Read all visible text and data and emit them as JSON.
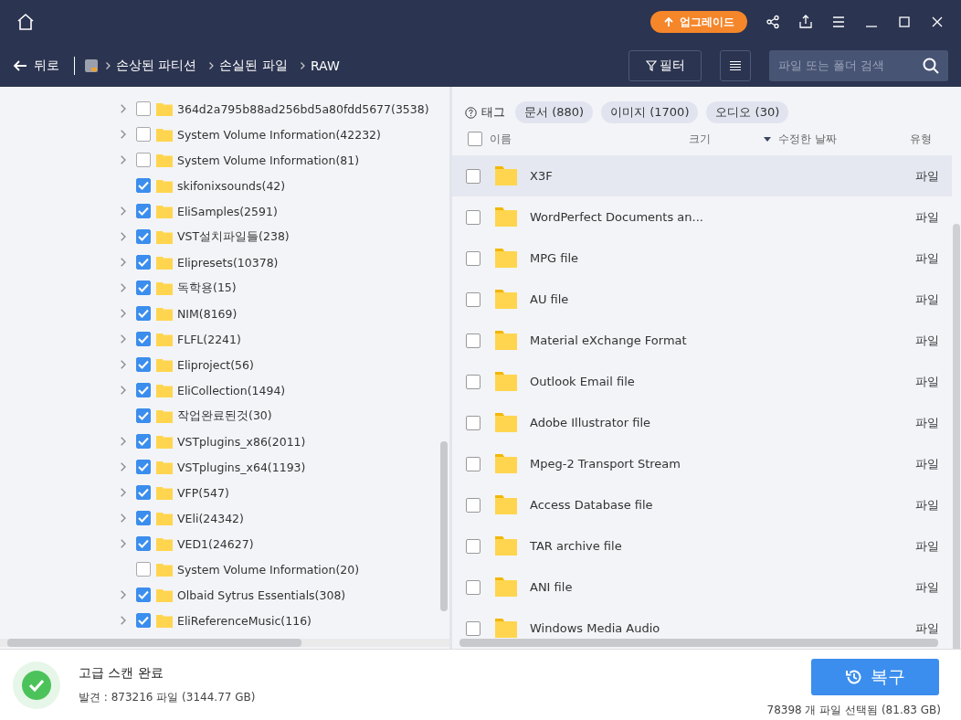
{
  "upgrade_button": "업그레이드",
  "nav": {
    "back": "뒤로",
    "breadcrumbs": [
      "손상된 파티션",
      "손실된 파일",
      "RAW"
    ],
    "filter": "필터",
    "search": {
      "placeholder": "파일 또는 폴더 검색"
    }
  },
  "tree": [
    {
      "label": "364d2a795b88ad256bd5a80fdd5677(3538)",
      "expandable": true,
      "checked": false
    },
    {
      "label": "System Volume Information(42232)",
      "expandable": true,
      "checked": false
    },
    {
      "label": "System Volume Information(81)",
      "expandable": true,
      "checked": false
    },
    {
      "label": "skifonixsounds(42)",
      "expandable": false,
      "checked": true
    },
    {
      "label": "EliSamples(2591)",
      "expandable": true,
      "checked": true
    },
    {
      "label": "VST설치파일들(238)",
      "expandable": true,
      "checked": true
    },
    {
      "label": "Elipresets(10378)",
      "expandable": true,
      "checked": true
    },
    {
      "label": "독학용(15)",
      "expandable": true,
      "checked": true
    },
    {
      "label": "NIM(8169)",
      "expandable": true,
      "checked": true
    },
    {
      "label": "FLFL(2241)",
      "expandable": true,
      "checked": true
    },
    {
      "label": "Eliproject(56)",
      "expandable": true,
      "checked": true
    },
    {
      "label": "EliCollection(1494)",
      "expandable": true,
      "checked": true
    },
    {
      "label": "작업완료된것(30)",
      "expandable": false,
      "checked": true
    },
    {
      "label": "VSTplugins_x86(2011)",
      "expandable": true,
      "checked": true
    },
    {
      "label": "VSTplugins_x64(1193)",
      "expandable": true,
      "checked": true
    },
    {
      "label": "VFP(547)",
      "expandable": true,
      "checked": true
    },
    {
      "label": "VEli(24342)",
      "expandable": true,
      "checked": true
    },
    {
      "label": "VED1(24627)",
      "expandable": true,
      "checked": true
    },
    {
      "label": "System Volume Information(20)",
      "expandable": false,
      "checked": false
    },
    {
      "label": "Olbaid Sytrus Essentials(308)",
      "expandable": true,
      "checked": true
    },
    {
      "label": "EliReferenceMusic(116)",
      "expandable": true,
      "checked": true
    }
  ],
  "tags": {
    "label": "태그",
    "items": [
      "문서 (880)",
      "이미지 (1700)",
      "오디오 (30)"
    ]
  },
  "table": {
    "columns": [
      "이름",
      "크기",
      "수정한 날짜",
      "유형"
    ],
    "header_checked": false,
    "rows": [
      {
        "name": "X3F",
        "type": "파일",
        "selected": true,
        "checked": false
      },
      {
        "name": "WordPerfect Documents an...",
        "type": "파일",
        "selected": false,
        "checked": false
      },
      {
        "name": "MPG file",
        "type": "파일",
        "selected": false,
        "checked": false
      },
      {
        "name": "AU file",
        "type": "파일",
        "selected": false,
        "checked": false
      },
      {
        "name": "Material eXchange Format",
        "type": "파일",
        "selected": false,
        "checked": false
      },
      {
        "name": "Outlook Email file",
        "type": "파일",
        "selected": false,
        "checked": false
      },
      {
        "name": "Adobe Illustrator file",
        "type": "파일",
        "selected": false,
        "checked": false
      },
      {
        "name": "Mpeg-2 Transport Stream",
        "type": "파일",
        "selected": false,
        "checked": false
      },
      {
        "name": "Access Database file",
        "type": "파일",
        "selected": false,
        "checked": false
      },
      {
        "name": "TAR archive file",
        "type": "파일",
        "selected": false,
        "checked": false
      },
      {
        "name": "ANI file",
        "type": "파일",
        "selected": false,
        "checked": false
      },
      {
        "name": "Windows Media Audio",
        "type": "파일",
        "selected": false,
        "checked": false
      }
    ]
  },
  "status": {
    "title": "고급 스캔 완료",
    "found": "발견 : 873216 파일 (3144.77 GB)",
    "recover": "복구",
    "selected_info": "78398 개 파일 선택됨 (81.83 GB)"
  }
}
